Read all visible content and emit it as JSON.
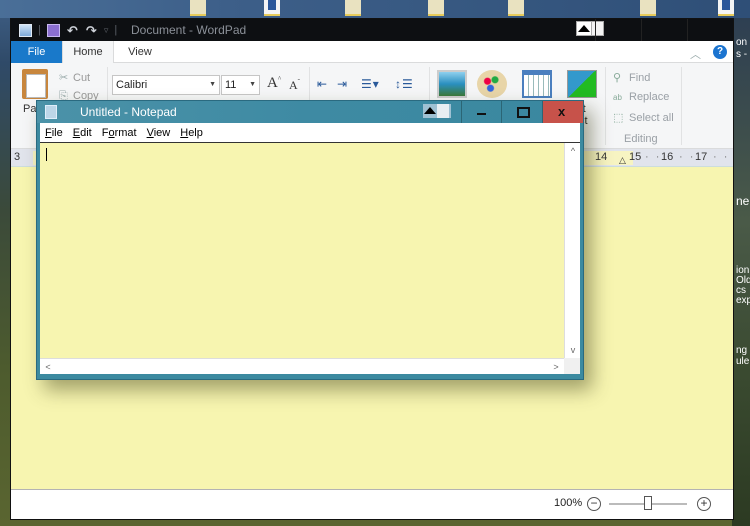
{
  "wordpad": {
    "title": "Document - WordPad",
    "quick_access": [
      "wordpad-icon",
      "save-icon",
      "undo-icon",
      "redo-icon",
      "customize-qat-icon"
    ],
    "tabs": [
      {
        "label": "File",
        "active": false,
        "accent": "#1979ca"
      },
      {
        "label": "Home",
        "active": true
      },
      {
        "label": "View",
        "active": false
      }
    ],
    "help_label": "?",
    "ribbon": {
      "clipboard": {
        "paste_label": "Pas",
        "cut_label": "Cut",
        "copy_label": "Copy"
      },
      "font": {
        "family": "Calibri",
        "size": "11",
        "grow_label": "A",
        "shrink_label": "A"
      },
      "paragraph": {
        "icons": [
          "decrease-indent-icon",
          "increase-indent-icon",
          "bullets-icon",
          "line-spacing-icon"
        ]
      },
      "insert": {
        "icons": [
          "picture-icon",
          "paint-drawing-icon",
          "date-time-icon",
          "insert-object-icon"
        ],
        "partial_label_1": "rt",
        "partial_label_2": "ct"
      },
      "editing": {
        "find_label": "Find",
        "replace_label": "Replace",
        "select_all_label": "Select all",
        "group_label": "Editing"
      }
    },
    "ruler": {
      "left_number": "3",
      "right_numbers": [
        "14",
        "15",
        "16",
        "17"
      ]
    },
    "status": {
      "zoom_percent": "100%",
      "zoom_minus": "−",
      "zoom_plus": "+",
      "zoom_level_fraction": 0.5
    }
  },
  "notepad": {
    "title": "Untitled - Notepad",
    "menu": [
      {
        "label": "File",
        "mnemonic": "F"
      },
      {
        "label": "Edit",
        "mnemonic": "E"
      },
      {
        "label": "Format",
        "mnemonic": "o"
      },
      {
        "label": "View",
        "mnemonic": "V"
      },
      {
        "label": "Help",
        "mnemonic": "H"
      }
    ],
    "content": "",
    "close_glyph": "x",
    "scroll_up": "^",
    "scroll_down": "v",
    "scroll_left": "<",
    "scroll_right": ">"
  },
  "desktop": {
    "side_text": [
      "on",
      "s -",
      "ne",
      "ion",
      "Old",
      "cs",
      "exp",
      "ng",
      "ule."
    ]
  },
  "colors": {
    "notepad_background": "#f7f5b0",
    "notepad_title_bar": "#3e8aa3",
    "close_button": "#c7524a",
    "file_tab": "#1979ca"
  }
}
